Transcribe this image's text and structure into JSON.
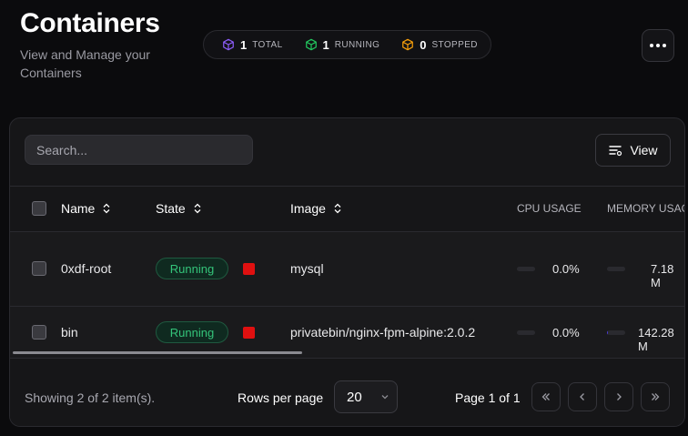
{
  "header": {
    "title": "Containers",
    "subtitle": "View and Manage your Containers"
  },
  "stats": [
    {
      "count": "1",
      "label": "TOTAL",
      "color": "#8b5cf6"
    },
    {
      "count": "1",
      "label": "RUNNING",
      "color": "#22c55e"
    },
    {
      "count": "0",
      "label": "STOPPED",
      "color": "#f59e0b"
    }
  ],
  "toolbar": {
    "search_placeholder": "Search...",
    "view_label": "View"
  },
  "table": {
    "columns": {
      "name": "Name",
      "state": "State",
      "image": "Image",
      "cpu": "CPU USAGE",
      "memory": "MEMORY USAGE"
    },
    "rows": [
      {
        "name": "0xdf-root",
        "state": "Running",
        "image": "mysql",
        "cpu": "0.0%",
        "cpu_fraction": 0.0,
        "memory": "7.18 M",
        "memory_fraction": 0.0
      },
      {
        "name": "bin",
        "state": "Running",
        "image": "privatebin/nginx-fpm-alpine:2.0.2",
        "cpu": "0.0%",
        "cpu_fraction": 0.0,
        "memory": "142.28 M",
        "memory_fraction": 0.06
      }
    ]
  },
  "footer": {
    "showing": "Showing 2 of 2 item(s).",
    "rows_per_page_label": "Rows per page",
    "rows_per_page_value": "20",
    "page_info": "Page 1 of 1"
  },
  "colors": {
    "running_text": "#34c47a",
    "stop_button": "#e01010",
    "accent": "#4b3cd6"
  }
}
